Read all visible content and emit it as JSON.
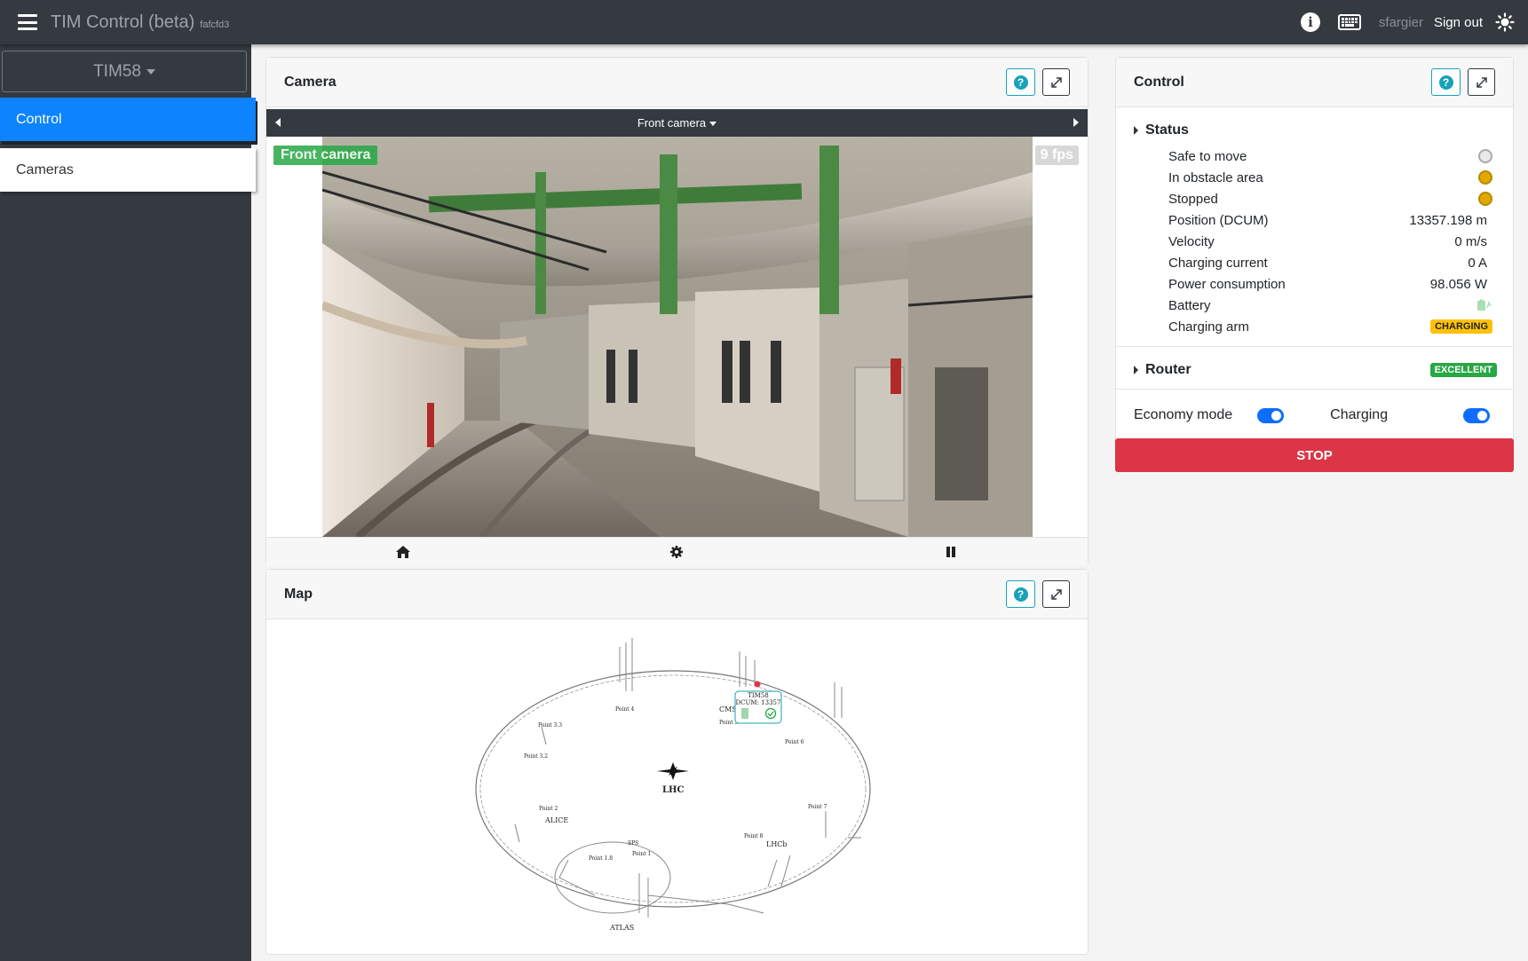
{
  "app": {
    "title": "TIM Control (beta)",
    "commit": "fafcfd3"
  },
  "header": {
    "user": "sfargier",
    "signout_label": "Sign out"
  },
  "sidebar": {
    "vehicle": "TIM58",
    "items": [
      {
        "label": "Control"
      },
      {
        "label": "Cameras"
      }
    ]
  },
  "camera": {
    "title": "Camera",
    "selected": "Front camera",
    "overlay_label": "Front camera",
    "fps": "9 fps"
  },
  "map": {
    "title": "Map",
    "labels": {
      "center": "LHC",
      "p1": "Point 1",
      "p18": "Point 1.8",
      "p2": "Point 2",
      "p32": "Point 3.2",
      "p33": "Point 3.3",
      "p4": "Point 4",
      "p5": "Point 5",
      "p6": "Point 6",
      "p7": "Point 7",
      "p8": "Point 8",
      "alice": "ALICE",
      "atlas": "ATLAS",
      "cms": "CMS",
      "lhcb": "LHCb",
      "sps": "SPS",
      "vehicle": "TIM58",
      "dcum": "DCUM: 13357"
    }
  },
  "control": {
    "title": "Control",
    "status_title": "Status",
    "rows": [
      {
        "label": "Safe to move",
        "kind": "dot-off"
      },
      {
        "label": "In obstacle area",
        "kind": "dot-warn"
      },
      {
        "label": "Stopped",
        "kind": "dot-warn"
      },
      {
        "label": "Position (DCUM)",
        "value": "13357.198 m"
      },
      {
        "label": "Velocity",
        "value": "0 m/s"
      },
      {
        "label": "Charging current",
        "value": "0 A"
      },
      {
        "label": "Power consumption",
        "value": "98.056 W"
      },
      {
        "label": "Battery",
        "kind": "battery-icon"
      },
      {
        "label": "Charging arm",
        "badge": "CHARGING"
      }
    ],
    "router_title": "Router",
    "router_badge": "EXCELLENT",
    "economy_label": "Economy mode",
    "charging_label": "Charging",
    "stop_label": "STOP"
  },
  "colors": {
    "navbar": "#343a40",
    "active": "#0d83fd",
    "stop": "#dc3545",
    "ok": "#28a745",
    "warn": "#ffc107",
    "info": "#17a2b8"
  }
}
